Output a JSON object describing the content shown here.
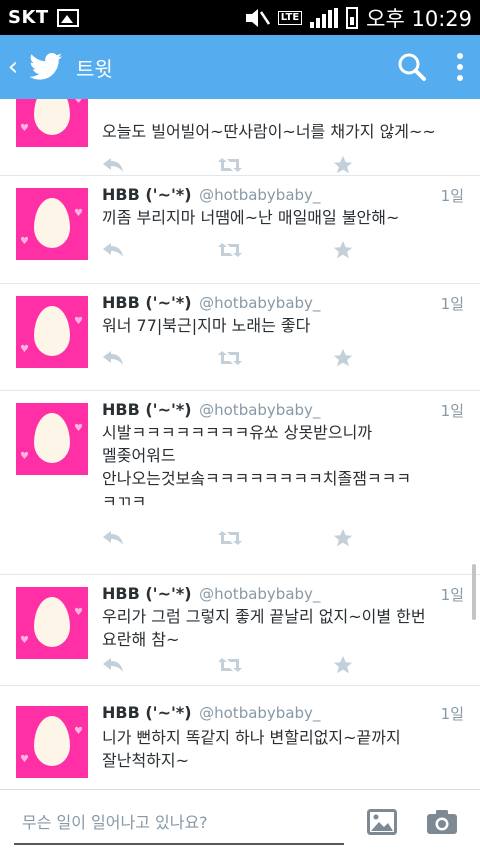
{
  "status_bar": {
    "carrier": "SKT",
    "network": "LTE",
    "time": "오후 10:29"
  },
  "action_bar": {
    "title": "트윗",
    "icons": [
      "back-icon",
      "twitter-bird-icon",
      "search-icon",
      "overflow-menu-icon"
    ]
  },
  "tweets": [
    {
      "name": "",
      "handle": "",
      "time": "",
      "text": "오늘도 빌어빌어~딴사람이~너를 채가지 않게~~"
    },
    {
      "name": "HBB ('~'*)",
      "handle": "@hotbabybaby_",
      "time": "1일",
      "text": "끼좀 부리지마 너땜에~난 매일매일 불안해~"
    },
    {
      "name": "HBB ('~'*)",
      "handle": "@hotbabybaby_",
      "time": "1일",
      "text": "워너 77|북근|지마 노래는 좋다"
    },
    {
      "name": "HBB ('~'*)",
      "handle": "@hotbabybaby_",
      "time": "1일",
      "text": "시발ㅋㅋㅋㅋㅋㅋㅋㅋ유쏘 상못받으니까\n멜좆어워드\n안나오는것보솤ㅋㅋㅋㅋㅋㅋㅋㅋ치졸잼ㅋㅋㅋ\nㅋㄲㅋ"
    },
    {
      "name": "HBB ('~'*)",
      "handle": "@hotbabybaby_",
      "time": "1일",
      "text": "우리가 그럼 그렇지 좋게 끝날리 없지~이별 한번\n요란해 참~"
    },
    {
      "name": "HBB ('~'*)",
      "handle": "@hotbabybaby_",
      "time": "1일",
      "text": "니가 뻔하지 똑같지 하나 변할리없지~끝까지\n잘난척하지~"
    }
  ],
  "tweet_action_icons": [
    "reply-icon",
    "retweet-icon",
    "favorite-star-icon"
  ],
  "compose": {
    "placeholder": "무슨 일이 일어나고 있나요?",
    "icons": [
      "photo-icon",
      "camera-icon"
    ]
  },
  "colors": {
    "accent": "#55acee",
    "avatar_bg": "#ff2fa6",
    "text": "#292f33",
    "muted": "#8899a6",
    "action_icon": "#c4d0d9"
  }
}
